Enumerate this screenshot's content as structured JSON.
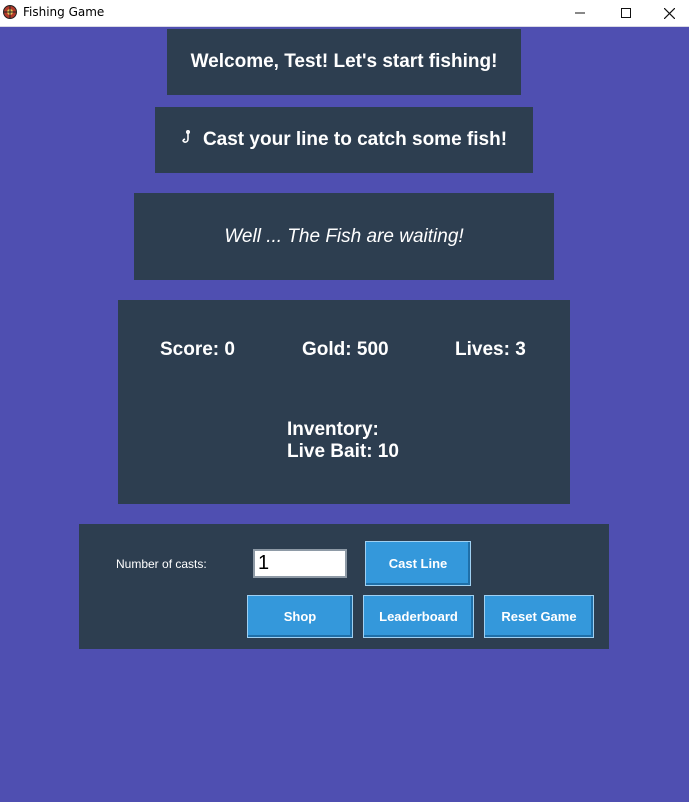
{
  "window": {
    "title": "Fishing Game",
    "icon": "fishing-game-app-icon",
    "controls": [
      "minimize-icon",
      "maximize-icon",
      "close-icon"
    ]
  },
  "welcome": {
    "text": "Welcome, Test! Let's start fishing!"
  },
  "prompt": {
    "icon": "fishing-hook-icon",
    "text": "Cast your line to catch some fish!"
  },
  "flavor": {
    "text": "Well ... The Fish are waiting!"
  },
  "stats": {
    "score": "Score: 0",
    "gold": "Gold: 500",
    "lives": "Lives: 3",
    "inventory_title": "Inventory:",
    "inventory_items": [
      "Live Bait: 10"
    ]
  },
  "controls": {
    "casts_label": "Number of casts:",
    "casts_value": "1",
    "cast_button": "Cast Line",
    "shop_button": "Shop",
    "leaderboard_button": "Leaderboard",
    "reset_button": "Reset Game"
  },
  "colors": {
    "background": "#4f4fb1",
    "panel": "#2d3e50",
    "button": "#3498db",
    "text": "#ffffff"
  }
}
